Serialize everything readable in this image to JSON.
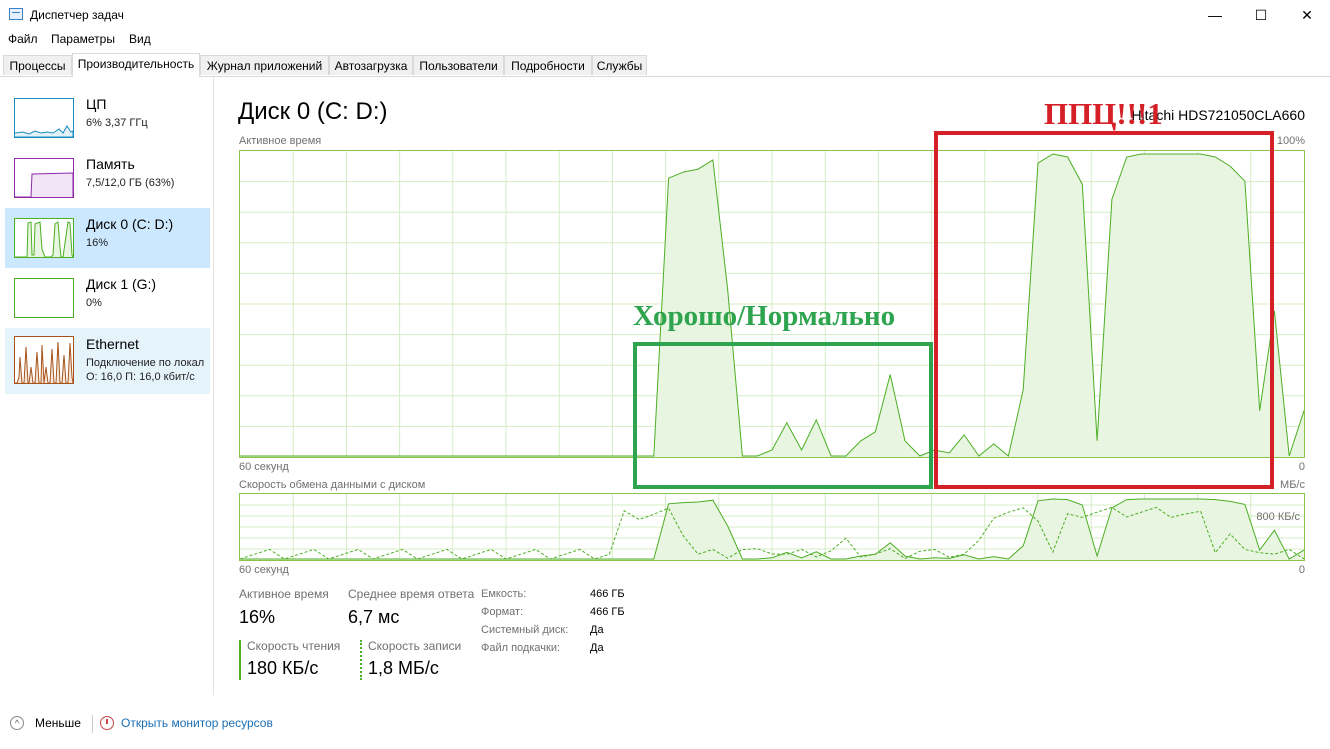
{
  "window": {
    "title": "Диспетчер задач",
    "minimize": "—",
    "maximize": "☐",
    "close": "✕"
  },
  "menu": {
    "file": "Файл",
    "params": "Параметры",
    "view": "Вид"
  },
  "tabs": [
    "Процессы",
    "Производительность",
    "Журнал приложений",
    "Автозагрузка",
    "Пользователи",
    "Подробности",
    "Службы"
  ],
  "sidebar": {
    "cpu": {
      "title": "ЦП",
      "sub": "6%  3,37 ГГц"
    },
    "memory": {
      "title": "Память",
      "sub": "7,5/12,0 ГБ (63%)"
    },
    "disk0": {
      "title": "Диск 0 (C: D:)",
      "sub": "16%"
    },
    "disk1": {
      "title": "Диск 1 (G:)",
      "sub": "0%"
    },
    "ethernet": {
      "title": "Ethernet",
      "sub": "Подключение по локал",
      "sub2": "О: 16,0  П: 16,0 кбит/с"
    }
  },
  "main": {
    "title": "Диск 0 (C: D:)",
    "model": "Hitachi HDS721050CLA660",
    "active_label": "Активное время",
    "active_max": "100%",
    "time_label_1": "60 секунд",
    "zero_1": "0",
    "rate_label": "Скорость обмена данными с диском",
    "rate_unit": "МБ/с",
    "rate_mid": "800 КБ/с",
    "time_label_2": "60 секунд",
    "zero_2": "0"
  },
  "stats": {
    "active_time_label": "Активное время",
    "active_time_value": "16%",
    "avg_response_label": "Среднее время ответа",
    "avg_response_value": "6,7 мс",
    "read_label": "Скорость чтения",
    "read_value": "180 КБ/с",
    "write_label": "Скорость записи",
    "write_value": "1,8 МБ/с"
  },
  "properties": [
    {
      "label": "Емкость:",
      "value": "466 ГБ"
    },
    {
      "label": "Формат:",
      "value": "466 ГБ"
    },
    {
      "label": "Системный диск:",
      "value": "Да"
    },
    {
      "label": "Файл подкачки:",
      "value": "Да"
    }
  ],
  "footer": {
    "less": "Меньше",
    "resource_monitor": "Открыть монитор ресурсов"
  },
  "annotations": {
    "green": "Хорошо/Нормально",
    "red": "ППЦ!!!1"
  },
  "colors": {
    "disk_line": "#4caf24",
    "disk_fill": "#e8f5e0",
    "grid": "#d4ecc4",
    "annot_green": "#2ea44f",
    "annot_red": "#d42026",
    "selected": "#cce8ff"
  },
  "chart_data": {
    "type": "area",
    "title": "Активное время",
    "ylim": [
      0,
      100
    ],
    "x": [
      0,
      1,
      2,
      3,
      4,
      5,
      6,
      7,
      8,
      9,
      10,
      11,
      12,
      13,
      14,
      15,
      16,
      17,
      18,
      19,
      20,
      21,
      22,
      23,
      24,
      25,
      26,
      27,
      28,
      29,
      30,
      31,
      32,
      33,
      34,
      35,
      36,
      37,
      38,
      39,
      40,
      41,
      42,
      43,
      44,
      45,
      46,
      47,
      48,
      49,
      50,
      51,
      52,
      53,
      54,
      55,
      56,
      57,
      58,
      59
    ],
    "values": [
      0,
      0,
      0,
      0,
      0,
      0,
      0,
      0,
      0,
      0,
      0,
      0,
      0,
      0,
      0,
      0,
      0,
      0,
      0,
      0,
      0,
      0,
      0,
      0,
      0,
      0,
      0,
      0,
      0,
      92,
      94,
      95,
      98,
      55,
      0,
      0,
      2,
      11,
      2,
      12,
      0,
      0,
      5,
      8,
      27,
      5,
      0,
      2,
      1,
      7,
      0,
      4,
      0,
      22,
      97,
      100,
      99,
      90,
      5,
      85,
      99,
      100,
      100,
      100,
      100,
      100,
      99,
      96,
      91,
      15,
      48,
      0,
      15
    ],
    "xlabel": "60 секунд",
    "ylabel": ""
  }
}
